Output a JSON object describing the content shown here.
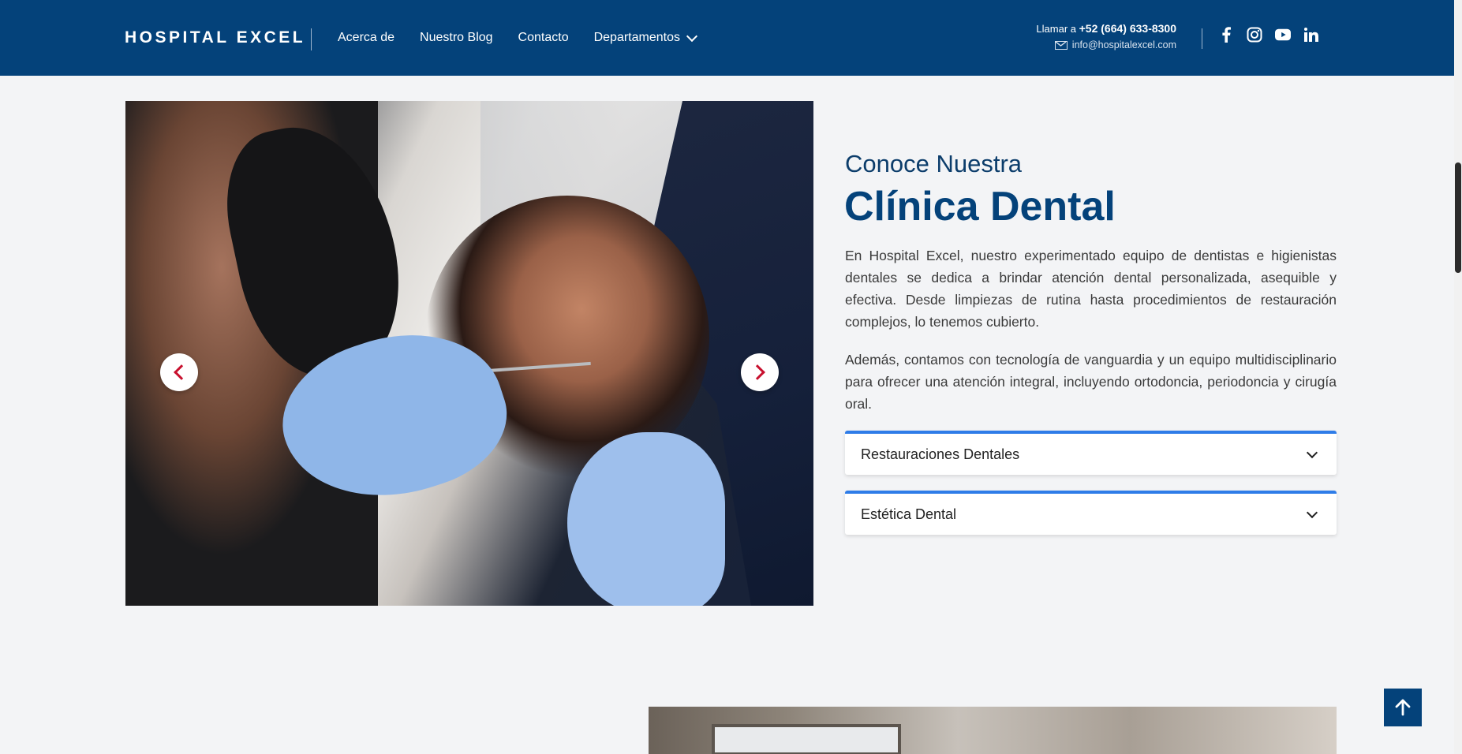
{
  "header": {
    "logo": "HOSPITAL EXCEL",
    "nav": [
      {
        "label": "Acerca de"
      },
      {
        "label": "Nuestro Blog"
      },
      {
        "label": "Contacto"
      },
      {
        "label": "Departamentos",
        "has_dropdown": true
      }
    ],
    "call_prefix": "Llamar a",
    "phone": "+52 (664) 633-8300",
    "email": "info@hospitalexcel.com",
    "social_icons": [
      "facebook-icon",
      "instagram-icon",
      "youtube-icon",
      "linkedin-icon"
    ]
  },
  "hero": {
    "image_alt_icons": [
      "chevron-left-icon",
      "chevron-right-icon"
    ]
  },
  "section": {
    "intro": "Conoce Nuestra",
    "title": "Clínica Dental",
    "paragraph1": "En Hospital Excel, nuestro experimentado equipo de dentistas e higienistas dentales se dedica a brindar atención dental personalizada, asequible y efectiva. Desde limpiezas de rutina hasta procedimientos de restauración complejos, lo tenemos cubierto.",
    "paragraph2": "Además, contamos con tecnología de vanguardia y un equipo multidisciplinario para ofrecer una atención integral, incluyendo ortodoncia, periodoncia y cirugía oral.",
    "accordions": [
      {
        "label": "Restauraciones Dentales"
      },
      {
        "label": "Estética Dental"
      }
    ]
  },
  "colors": {
    "brand_blue": "#04427a",
    "accent_blue": "#2e7ce8",
    "carousel_arrow": "#c8102e",
    "background": "#f3f4f6"
  }
}
